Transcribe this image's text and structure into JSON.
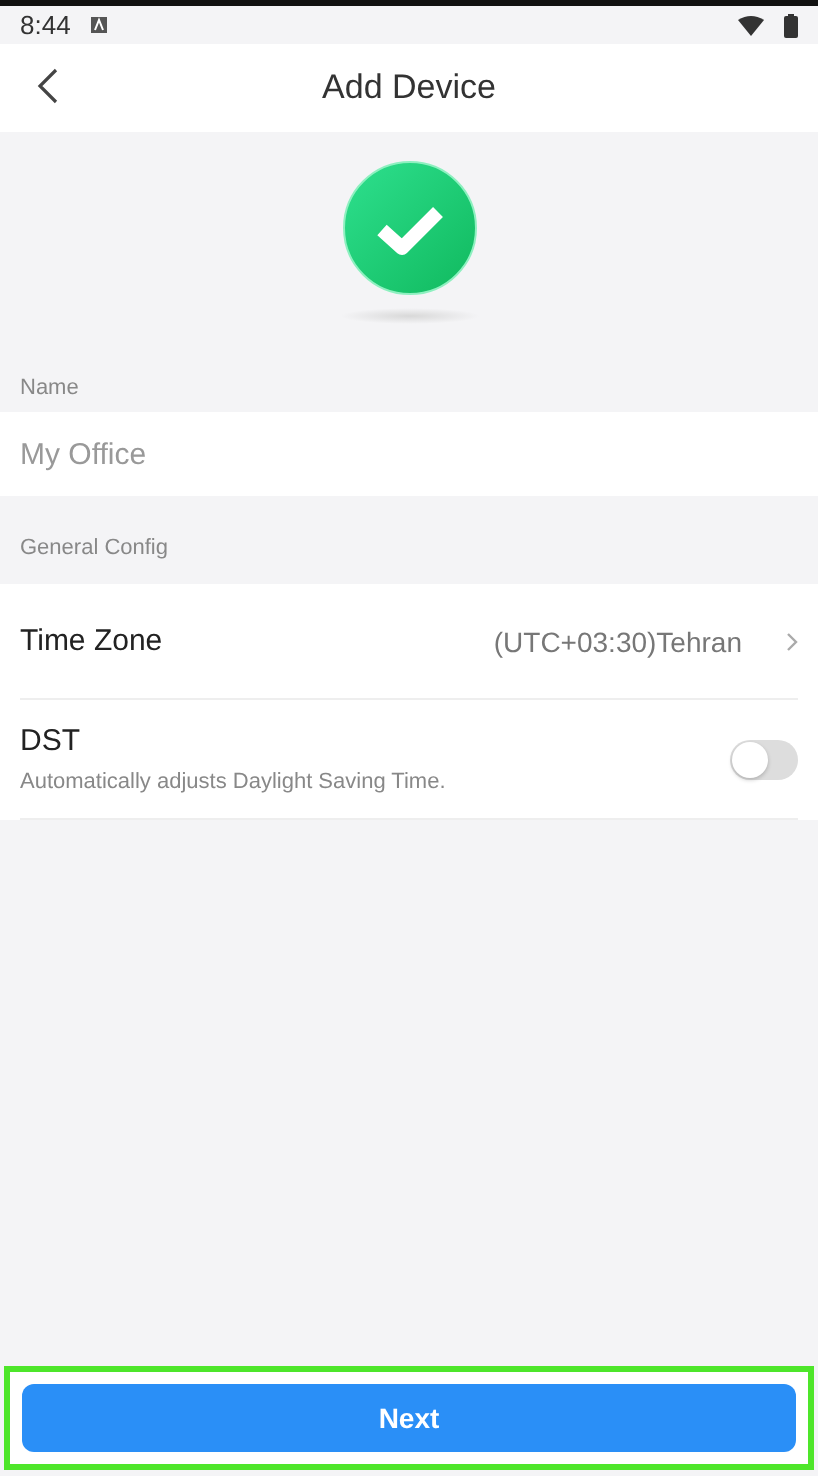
{
  "status_bar": {
    "time": "8:44"
  },
  "header": {
    "title": "Add Device"
  },
  "name_section": {
    "label": "Name",
    "placeholder": "My Office"
  },
  "config_section": {
    "label": "General Config"
  },
  "rows": [
    {
      "kind": "link",
      "label": "Time Zone",
      "value": "(UTC+03:30)Tehran"
    },
    {
      "kind": "toggle",
      "label": "DST",
      "description": "Automatically adjusts Daylight Saving Time.",
      "on": false
    }
  ],
  "footer": {
    "button": "Next",
    "highlighted": true
  }
}
